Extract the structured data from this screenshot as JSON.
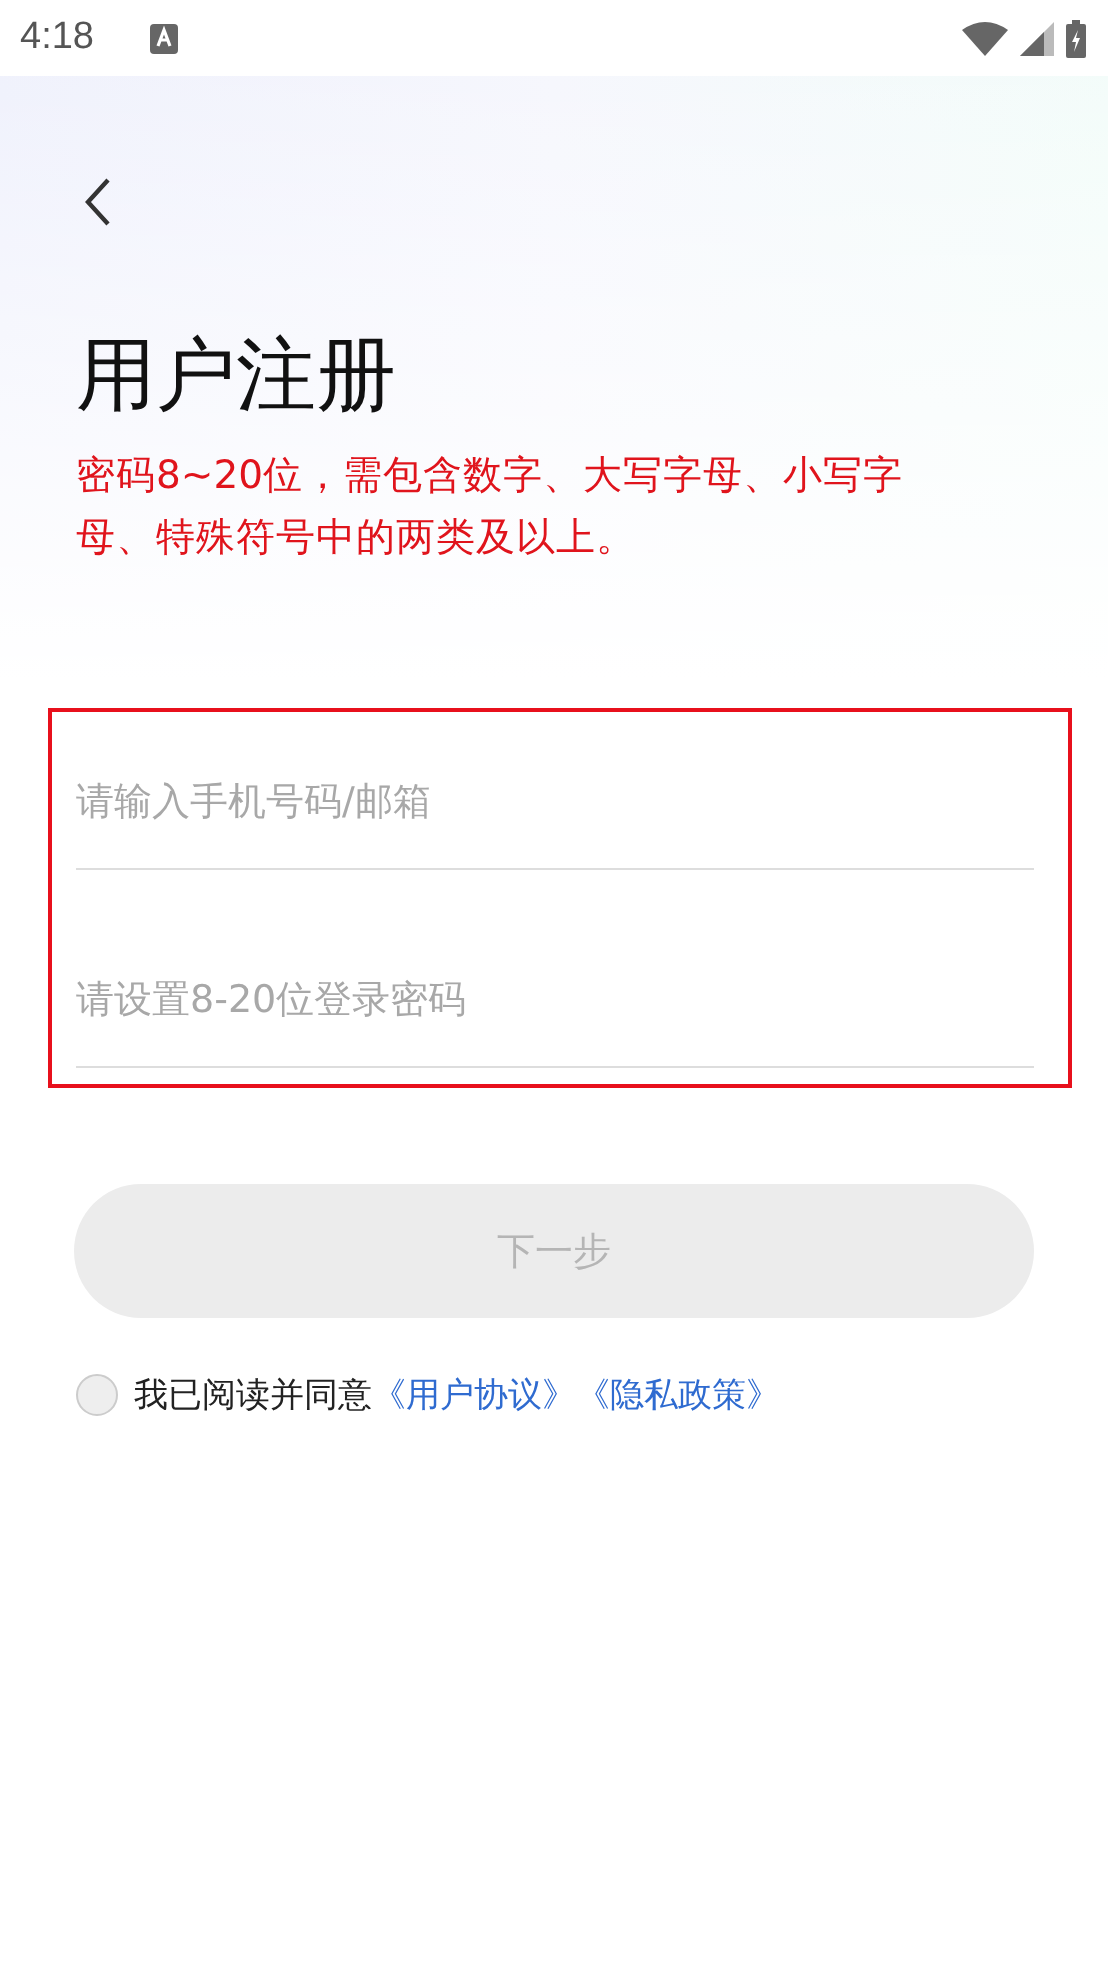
{
  "status_bar": {
    "time": "4:18"
  },
  "title": "用户注册",
  "hint": "密码8~20位，需包含数字、大写字母、小写字母、特殊符号中的两类及以上。",
  "fields": [
    {
      "placeholder": "请输入手机号码/邮箱"
    },
    {
      "placeholder": "请设置8-20位登录密码"
    }
  ],
  "next_button": {
    "label": "下一步",
    "disabled": true
  },
  "agreement": {
    "checked": false,
    "text": "我已阅读并同意",
    "links": [
      "《用户协议》",
      "《隐私政策》"
    ]
  }
}
